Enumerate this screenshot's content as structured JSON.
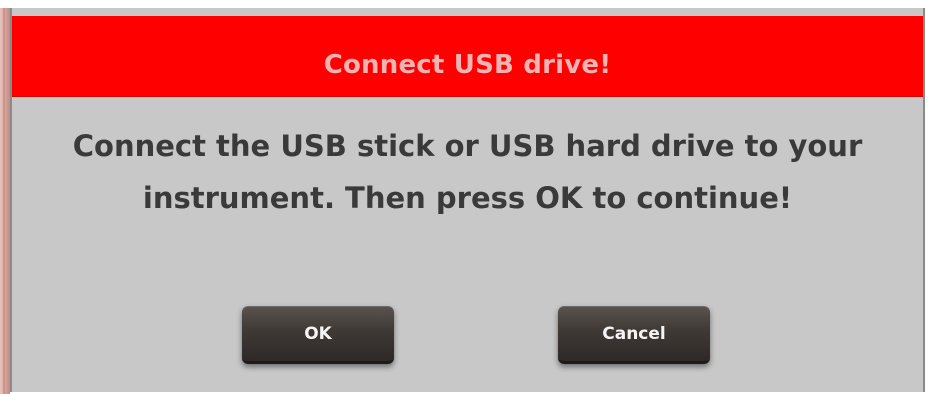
{
  "dialog": {
    "title": "Connect USB drive!",
    "message_line1": "Connect the USB stick or USB hard drive to your",
    "message_line2": "instrument. Then press OK to continue!",
    "ok_label": "OK",
    "cancel_label": "Cancel"
  },
  "colors": {
    "titlebar": "#ff0000",
    "title_text": "#f2b3b3",
    "dialog_bg": "#c8c8c8",
    "message_text": "#3a3a3a",
    "button_bg": "#3f3936",
    "button_text": "#f4f4f4"
  }
}
